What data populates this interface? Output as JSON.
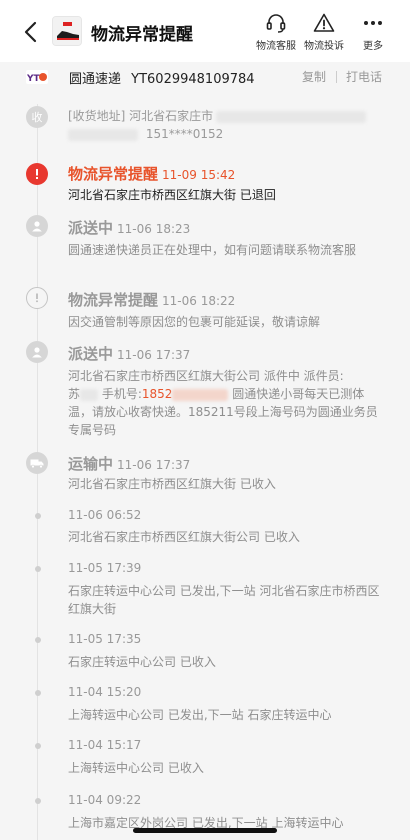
{
  "header": {
    "title": "物流异常提醒",
    "actions": [
      {
        "label": "物流客服",
        "icon": "headset-icon"
      },
      {
        "label": "物流投诉",
        "icon": "warning-icon"
      },
      {
        "label": "更多",
        "icon": "more-icon"
      }
    ]
  },
  "carrier": {
    "name": "圆通速递",
    "tracking_no": "YT6029948109784",
    "copy_label": "复制",
    "call_label": "打电话"
  },
  "receive": {
    "node_label": "收",
    "line1": "[收货地址] 河北省石家庄市",
    "line2_tail": "151****0152"
  },
  "events": [
    {
      "status": "物流异常提醒",
      "time": "11-09 15:42",
      "text": "河北省石家庄市桥西区红旗大街 已退回",
      "type": "alert"
    },
    {
      "status": "派送中",
      "time": "11-06 18:23",
      "text": "圆通速递快递员正在处理中，如有问题请联系物流客服",
      "type": "courier"
    },
    {
      "status": "物流异常提醒",
      "time": "11-06 18:22",
      "text": "因交通管制等原因您的包裹可能延误，敬请谅解",
      "type": "notice"
    },
    {
      "status": "派送中",
      "time": "11-06 17:37",
      "text_a": "河北省石家庄市桥西区红旗大街公司 派件中 派件员:",
      "text_b1": "苏",
      "text_b2": " 手机号:",
      "phone_prefix": "1852",
      "text_c": "圆通快递小哥每天已测体温，请放心收寄快递。185211号段上海号码为圆通业务员专属号码",
      "type": "courier"
    },
    {
      "status": "运输中",
      "time": "11-06 17:37",
      "text": "河北省石家庄市桥西区红旗大街 已收入",
      "type": "truck"
    },
    {
      "time": "11-06 06:52",
      "text": "河北省石家庄市桥西区红旗大街公司 已收入"
    },
    {
      "time": "11-05 17:39",
      "text": "石家庄转运中心公司 已发出,下一站 河北省石家庄市桥西区红旗大街"
    },
    {
      "time": "11-05 17:35",
      "text": "石家庄转运中心公司 已收入"
    },
    {
      "time": "11-04 15:20",
      "text": "上海转运中心公司 已发出,下一站 石家庄转运中心"
    },
    {
      "time": "11-04 15:17",
      "text": "上海转运中心公司 已收入"
    },
    {
      "time": "11-04 09:22",
      "text": "上海市嘉定区外岗公司 已发出,下一站 上海转运中心"
    }
  ],
  "colors": {
    "accent": "#e8542c",
    "alert_node": "#e8382f",
    "background": "#f5f5f5"
  }
}
